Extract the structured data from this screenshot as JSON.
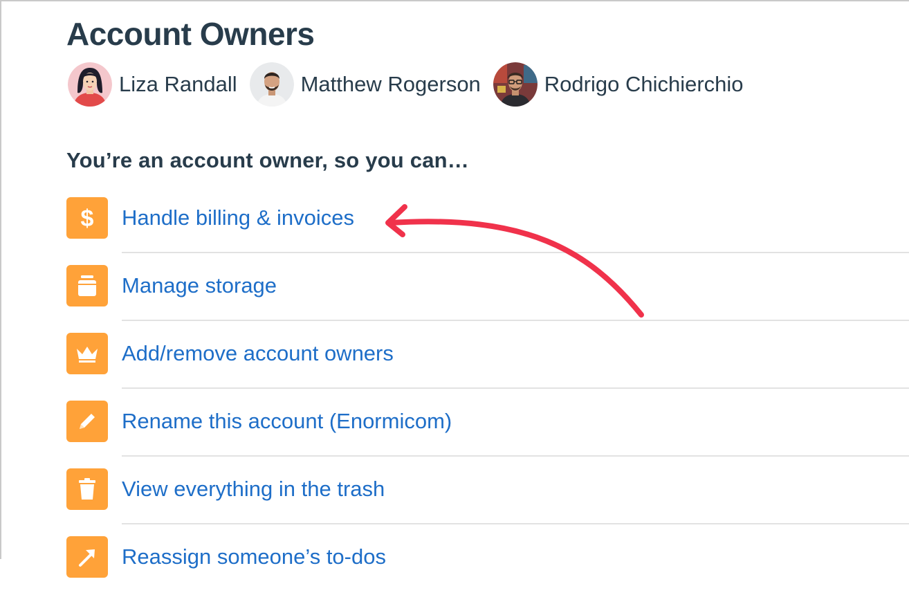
{
  "page": {
    "title": "Account Owners",
    "subheading": "You’re an account owner, so you can…"
  },
  "owners": [
    {
      "name": "Liza Randall",
      "avatar_icon": "woman-avatar"
    },
    {
      "name": "Matthew Rogerson",
      "avatar_icon": "man-avatar"
    },
    {
      "name": "Rodrigo Chichierchio",
      "avatar_icon": "man-glasses-avatar"
    }
  ],
  "permissions": [
    {
      "label": "Handle billing & invoices",
      "icon": "dollar-icon"
    },
    {
      "label": "Manage storage",
      "icon": "storage-box-icon"
    },
    {
      "label": "Add/remove account owners",
      "icon": "crown-icon"
    },
    {
      "label": "Rename this account (Enormicom)",
      "icon": "pencil-icon"
    },
    {
      "label": "View everything in the trash",
      "icon": "trash-icon"
    },
    {
      "label": "Reassign someone’s to-dos",
      "icon": "reassign-arrow-icon"
    }
  ],
  "colors": {
    "heading": "#283c4b",
    "link": "#1e6ec8",
    "icon_bg": "#ffa239",
    "annotation_arrow": "#f0324b"
  }
}
